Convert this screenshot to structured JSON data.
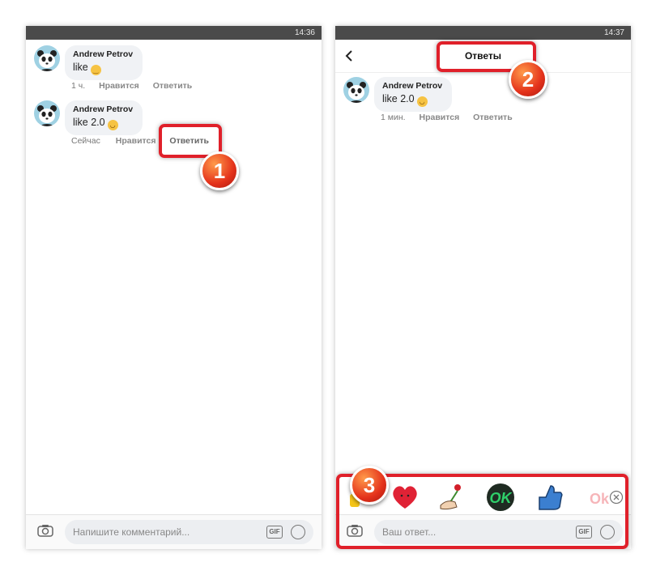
{
  "left": {
    "status_time": "14:36",
    "comments": [
      {
        "author": "Andrew Petrov",
        "text": "like",
        "emoji": "grinning-emoji",
        "time": "1 ч.",
        "like_label": "Нравится",
        "reply_label": "Ответить"
      },
      {
        "author": "Andrew Petrov",
        "text": "like 2.0",
        "emoji": "smiling-emoji",
        "time": "Сейчас",
        "like_label": "Нравится",
        "reply_label": "Ответить"
      }
    ],
    "input_placeholder": "Напишите комментарий..."
  },
  "right": {
    "status_time": "14:37",
    "title": "Ответы",
    "comment": {
      "author": "Andrew Petrov",
      "text": "like 2.0",
      "emoji": "smiling-emoji",
      "time": "1 мин.",
      "like_label": "Нравится",
      "reply_label": "Ответить"
    },
    "stickers": [
      "heart-sticker",
      "hand-rose-sticker",
      "ok-sticker",
      "thumbs-up-sticker",
      "ok-faded-sticker"
    ],
    "input_placeholder": "Ваш ответ..."
  },
  "badges": [
    "1",
    "2",
    "3"
  ],
  "gif_label": "GIF",
  "colors": {
    "highlight": "#e0202a",
    "bubble": "#f0f2f5",
    "statusbar": "#4a4a4a"
  }
}
